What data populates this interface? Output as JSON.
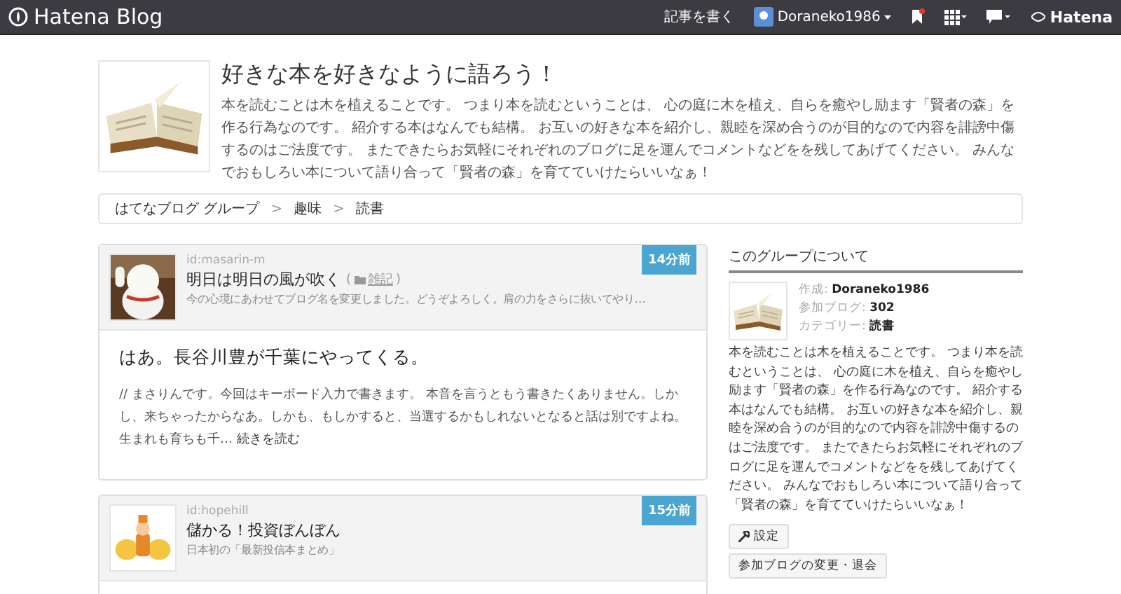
{
  "topbar": {
    "logo": "Hatena Blog",
    "write": "記事を書く",
    "user": "Doraneko1986",
    "brand": "Hatena",
    "notification": true
  },
  "group": {
    "title": "好きな本を好きなように語ろう！",
    "description": "本を読むことは木を植えることです。 つまり本を読むということは、 心の庭に木を植え、自らを癒やし励ます「賢者の森」を作る行為なのです。 紹介する本はなんでも結構。 お互いの好きな本を紹介し、親睦を深め合うのが目的なので内容を誹謗中傷するのはご法度です。 またできたらお気軽にそれぞれのブログに足を運んでコメントなどをを残してあげてください。 みんなでおもしろい本について語り合って「賢者の森」を育てていけたらいいなぁ！"
  },
  "breadcrumb": [
    "はてなブログ グループ",
    "趣味",
    "読書"
  ],
  "breadcrumb_separator": ">",
  "posts": [
    {
      "user": "id:masarin-m",
      "blog": "明日は明日の風が吹く",
      "category": "雑記",
      "category_brackets": [
        "(",
        ")"
      ],
      "blog_description": "今の心境にあわせてブログ名を変更しました。どうぞよろしく。肩の力をさらに抜いてやり…",
      "time": "14分前",
      "title": "はあ。長谷川豊が千葉にやってくる。",
      "excerpt": "// まさりんです。今回はキーボード入力で書きます。 本音を言うともう書きたくありません。しかし、来ちゃったからなあ。しかも、もしかすると、当選するかもしれないとなると話は別ですよね。生まれも育ちも千…",
      "more": "続きを読む"
    },
    {
      "user": "id:hopehill",
      "blog": "儲かる！投資ぼんぼん",
      "blog_description": "日本初の「最新投信本まとめ」",
      "time": "15分前"
    }
  ],
  "sidebar": {
    "heading": "このグループについて",
    "created_label": "作成: ",
    "created": "Doraneko1986",
    "blogs_label": "参加ブログ: ",
    "blogs": "302",
    "category_label": "カテゴリー: ",
    "category": "読書",
    "description": "本を読むことは木を植えることです。 つまり本を読むということは、 心の庭に木を植え、自らを癒やし励ます「賢者の森」を作る行為なのです。 紹介する本はなんでも結構。 お互いの好きな本を紹介し、親睦を深め合うのが目的なので内容を誹謗中傷するのはご法度です。 またできたらお気軽にそれぞれのブログに足を運んでコメントなどをを残してあげてください。 みんなでおもしろい本について語り合って「賢者の森」を育てていけたらいいなぁ！",
    "settings": "設定",
    "manage": "参加ブログの変更・退会"
  }
}
